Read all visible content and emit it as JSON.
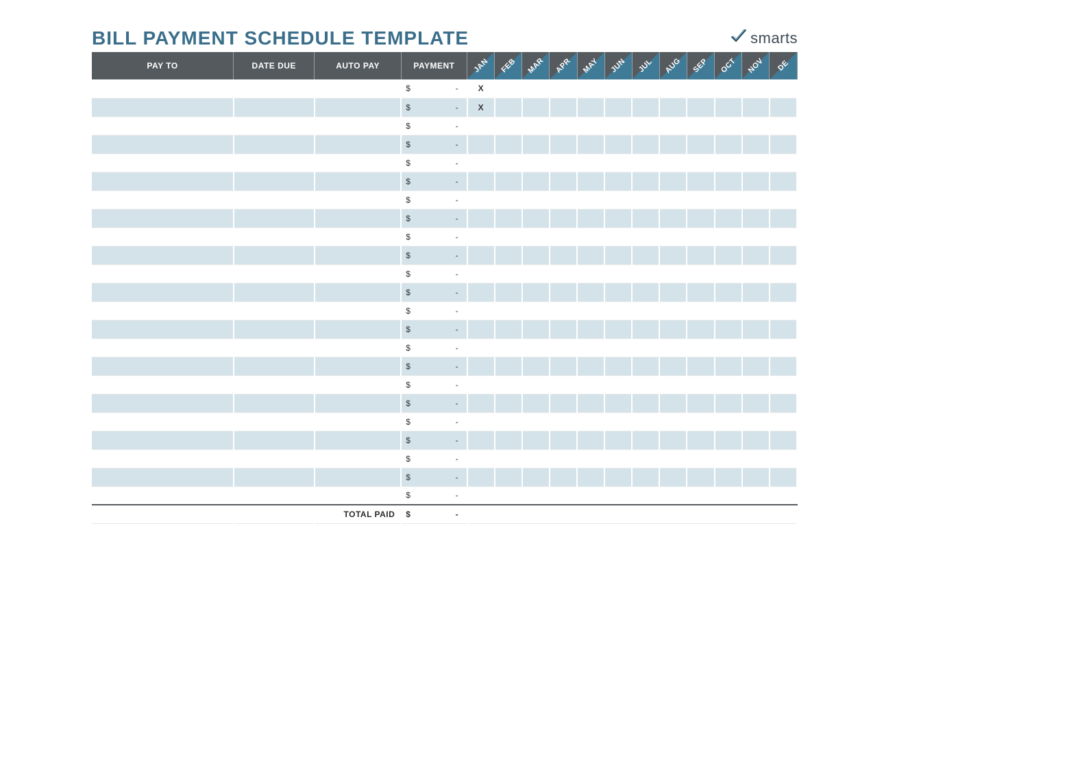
{
  "title": "BILL PAYMENT SCHEDULE TEMPLATE",
  "logo_text": "smarts",
  "columns": {
    "pay_to": "PAY TO",
    "date_due": "DATE DUE",
    "auto_pay": "AUTO PAY",
    "payment": "PAYMENT",
    "months": [
      "JAN",
      "FEB",
      "MAR",
      "APR",
      "MAY",
      "JUN",
      "JUL",
      "AUG",
      "SEP",
      "OCT",
      "NOV",
      "DE"
    ]
  },
  "currency_symbol": "$",
  "empty_value": "-",
  "rows": [
    {
      "pay_to": "",
      "date_due": "",
      "auto_pay": "",
      "payment": "-",
      "marks": [
        "X",
        "",
        "",
        "",
        "",
        "",
        "",
        "",
        "",
        "",
        "",
        ""
      ]
    },
    {
      "pay_to": "",
      "date_due": "",
      "auto_pay": "",
      "payment": "-",
      "marks": [
        "X",
        "",
        "",
        "",
        "",
        "",
        "",
        "",
        "",
        "",
        "",
        ""
      ]
    },
    {
      "pay_to": "",
      "date_due": "",
      "auto_pay": "",
      "payment": "-",
      "marks": [
        "",
        "",
        "",
        "",
        "",
        "",
        "",
        "",
        "",
        "",
        "",
        ""
      ]
    },
    {
      "pay_to": "",
      "date_due": "",
      "auto_pay": "",
      "payment": "-",
      "marks": [
        "",
        "",
        "",
        "",
        "",
        "",
        "",
        "",
        "",
        "",
        "",
        ""
      ]
    },
    {
      "pay_to": "",
      "date_due": "",
      "auto_pay": "",
      "payment": "-",
      "marks": [
        "",
        "",
        "",
        "",
        "",
        "",
        "",
        "",
        "",
        "",
        "",
        ""
      ]
    },
    {
      "pay_to": "",
      "date_due": "",
      "auto_pay": "",
      "payment": "-",
      "marks": [
        "",
        "",
        "",
        "",
        "",
        "",
        "",
        "",
        "",
        "",
        "",
        ""
      ]
    },
    {
      "pay_to": "",
      "date_due": "",
      "auto_pay": "",
      "payment": "-",
      "marks": [
        "",
        "",
        "",
        "",
        "",
        "",
        "",
        "",
        "",
        "",
        "",
        ""
      ]
    },
    {
      "pay_to": "",
      "date_due": "",
      "auto_pay": "",
      "payment": "-",
      "marks": [
        "",
        "",
        "",
        "",
        "",
        "",
        "",
        "",
        "",
        "",
        "",
        ""
      ]
    },
    {
      "pay_to": "",
      "date_due": "",
      "auto_pay": "",
      "payment": "-",
      "marks": [
        "",
        "",
        "",
        "",
        "",
        "",
        "",
        "",
        "",
        "",
        "",
        ""
      ]
    },
    {
      "pay_to": "",
      "date_due": "",
      "auto_pay": "",
      "payment": "-",
      "marks": [
        "",
        "",
        "",
        "",
        "",
        "",
        "",
        "",
        "",
        "",
        "",
        ""
      ]
    },
    {
      "pay_to": "",
      "date_due": "",
      "auto_pay": "",
      "payment": "-",
      "marks": [
        "",
        "",
        "",
        "",
        "",
        "",
        "",
        "",
        "",
        "",
        "",
        ""
      ]
    },
    {
      "pay_to": "",
      "date_due": "",
      "auto_pay": "",
      "payment": "-",
      "marks": [
        "",
        "",
        "",
        "",
        "",
        "",
        "",
        "",
        "",
        "",
        "",
        ""
      ]
    },
    {
      "pay_to": "",
      "date_due": "",
      "auto_pay": "",
      "payment": "-",
      "marks": [
        "",
        "",
        "",
        "",
        "",
        "",
        "",
        "",
        "",
        "",
        "",
        ""
      ]
    },
    {
      "pay_to": "",
      "date_due": "",
      "auto_pay": "",
      "payment": "-",
      "marks": [
        "",
        "",
        "",
        "",
        "",
        "",
        "",
        "",
        "",
        "",
        "",
        ""
      ]
    },
    {
      "pay_to": "",
      "date_due": "",
      "auto_pay": "",
      "payment": "-",
      "marks": [
        "",
        "",
        "",
        "",
        "",
        "",
        "",
        "",
        "",
        "",
        "",
        ""
      ]
    },
    {
      "pay_to": "",
      "date_due": "",
      "auto_pay": "",
      "payment": "-",
      "marks": [
        "",
        "",
        "",
        "",
        "",
        "",
        "",
        "",
        "",
        "",
        "",
        ""
      ]
    },
    {
      "pay_to": "",
      "date_due": "",
      "auto_pay": "",
      "payment": "-",
      "marks": [
        "",
        "",
        "",
        "",
        "",
        "",
        "",
        "",
        "",
        "",
        "",
        ""
      ]
    },
    {
      "pay_to": "",
      "date_due": "",
      "auto_pay": "",
      "payment": "-",
      "marks": [
        "",
        "",
        "",
        "",
        "",
        "",
        "",
        "",
        "",
        "",
        "",
        ""
      ]
    },
    {
      "pay_to": "",
      "date_due": "",
      "auto_pay": "",
      "payment": "-",
      "marks": [
        "",
        "",
        "",
        "",
        "",
        "",
        "",
        "",
        "",
        "",
        "",
        ""
      ]
    },
    {
      "pay_to": "",
      "date_due": "",
      "auto_pay": "",
      "payment": "-",
      "marks": [
        "",
        "",
        "",
        "",
        "",
        "",
        "",
        "",
        "",
        "",
        "",
        ""
      ]
    },
    {
      "pay_to": "",
      "date_due": "",
      "auto_pay": "",
      "payment": "-",
      "marks": [
        "",
        "",
        "",
        "",
        "",
        "",
        "",
        "",
        "",
        "",
        "",
        ""
      ]
    },
    {
      "pay_to": "",
      "date_due": "",
      "auto_pay": "",
      "payment": "-",
      "marks": [
        "",
        "",
        "",
        "",
        "",
        "",
        "",
        "",
        "",
        "",
        "",
        ""
      ]
    },
    {
      "pay_to": "",
      "date_due": "",
      "auto_pay": "",
      "payment": "-",
      "marks": [
        "",
        "",
        "",
        "",
        "",
        "",
        "",
        "",
        "",
        "",
        "",
        ""
      ]
    }
  ],
  "total": {
    "label": "TOTAL PAID",
    "symbol": "$",
    "value": "-"
  }
}
